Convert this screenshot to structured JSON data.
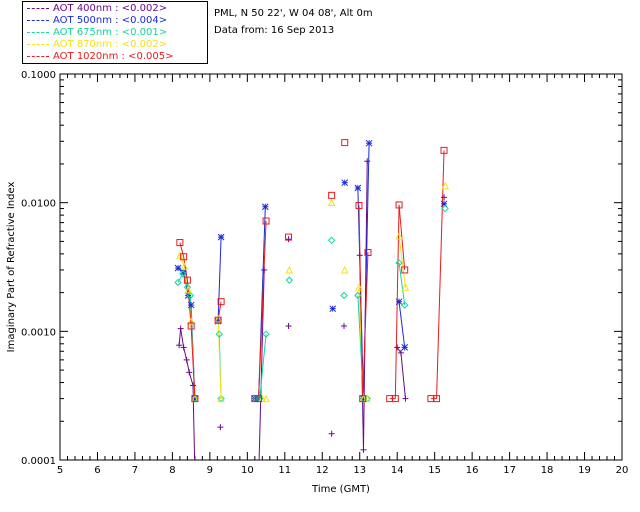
{
  "header": {
    "site": "PML, N 50 22', W 04 08', Alt 0m",
    "date": "Data from: 16 Sep 2013"
  },
  "chart_data": {
    "type": "scatter",
    "log_y": true,
    "xlabel": "Time (GMT)",
    "ylabel": "Imaginary Part of Refractive Index",
    "xlim": [
      5,
      20
    ],
    "ylim": [
      0.0001,
      0.1
    ],
    "x_ticks": [
      "5",
      "6",
      "7",
      "8",
      "9",
      "10",
      "11",
      "12",
      "13",
      "14",
      "15",
      "16",
      "17",
      "18",
      "19",
      "20"
    ],
    "y_ticks": [
      {
        "value": 0.0001,
        "label": "0.0001"
      },
      {
        "value": 0.001,
        "label": "0.0010"
      },
      {
        "value": 0.01,
        "label": "0.0100"
      },
      {
        "value": 0.1,
        "label": "0.1000"
      }
    ],
    "legend_position": "top-left (outside plot)",
    "series": [
      {
        "name": "AOT  400nm : <0.002>",
        "color": "#6a0a8c",
        "marker": "plus",
        "points": [
          [
            8.18,
            0.00078
          ],
          [
            8.22,
            0.00105
          ],
          [
            8.3,
            0.00075
          ],
          [
            8.38,
            0.0006
          ],
          [
            8.45,
            0.00048
          ],
          [
            8.55,
            0.00038
          ],
          [
            8.6,
            8e-05
          ],
          [
            9.28,
            0.00018
          ],
          [
            10.3,
            7e-05
          ],
          [
            10.45,
            0.003
          ],
          [
            11.1,
            0.0011
          ],
          [
            11.1,
            0.0052
          ],
          [
            12.25,
            0.00016
          ],
          [
            12.58,
            0.0011
          ],
          [
            13.0,
            0.0039
          ],
          [
            13.1,
            0.00012
          ],
          [
            13.2,
            0.021
          ],
          [
            14.0,
            0.00075
          ],
          [
            14.1,
            0.00068
          ],
          [
            14.22,
            0.0003
          ],
          [
            15.25,
            0.011
          ]
        ],
        "segments": [
          [
            0,
            1
          ],
          [
            1,
            2
          ],
          [
            2,
            3
          ],
          [
            3,
            4
          ],
          [
            4,
            5
          ],
          [
            5,
            6
          ],
          [
            8,
            9
          ],
          [
            14,
            15
          ],
          [
            15,
            16
          ],
          [
            17,
            18
          ],
          [
            18,
            19
          ]
        ]
      },
      {
        "name": "AOT  500nm : <0.004>",
        "color": "#1a2ad8",
        "marker": "star",
        "points": [
          [
            8.15,
            0.0031
          ],
          [
            8.3,
            0.0029
          ],
          [
            8.42,
            0.0019
          ],
          [
            8.5,
            0.0016
          ],
          [
            8.6,
            0.0003
          ],
          [
            9.22,
            0.0012
          ],
          [
            9.3,
            0.0054
          ],
          [
            10.2,
            0.0003
          ],
          [
            10.3,
            0.0003
          ],
          [
            10.48,
            0.0093
          ],
          [
            12.28,
            0.0015
          ],
          [
            12.6,
            0.0143
          ],
          [
            12.95,
            0.013
          ],
          [
            13.1,
            0.0003
          ],
          [
            13.25,
            0.029
          ],
          [
            14.05,
            0.0017
          ],
          [
            14.2,
            0.00075
          ],
          [
            15.25,
            0.0098
          ]
        ],
        "segments": [
          [
            0,
            1
          ],
          [
            1,
            2
          ],
          [
            2,
            3
          ],
          [
            3,
            4
          ],
          [
            5,
            6
          ],
          [
            7,
            8
          ],
          [
            8,
            9
          ],
          [
            12,
            13
          ],
          [
            13,
            14
          ],
          [
            15,
            16
          ]
        ]
      },
      {
        "name": "AOT  675nm : <0.001>",
        "color": "#14d4a0",
        "marker": "diamond",
        "points": [
          [
            8.15,
            0.0024
          ],
          [
            8.28,
            0.0028
          ],
          [
            8.4,
            0.0022
          ],
          [
            8.48,
            0.0019
          ],
          [
            8.6,
            0.0003
          ],
          [
            9.25,
            0.00095
          ],
          [
            9.3,
            0.0003
          ],
          [
            10.25,
            0.0003
          ],
          [
            10.33,
            0.0003
          ],
          [
            10.5,
            0.00095
          ],
          [
            11.12,
            0.0025
          ],
          [
            12.25,
            0.0051
          ],
          [
            12.58,
            0.0019
          ],
          [
            12.95,
            0.0019
          ],
          [
            13.1,
            0.0003
          ],
          [
            13.2,
            0.0003
          ],
          [
            14.05,
            0.0034
          ],
          [
            14.2,
            0.0016
          ],
          [
            15.28,
            0.009
          ]
        ],
        "segments": [
          [
            0,
            1
          ],
          [
            1,
            2
          ],
          [
            2,
            3
          ],
          [
            3,
            4
          ],
          [
            5,
            6
          ],
          [
            7,
            8
          ],
          [
            8,
            9
          ],
          [
            13,
            14
          ],
          [
            16,
            17
          ]
        ]
      },
      {
        "name": "AOT  870nm : <0.002>",
        "color": "#f2e21a",
        "marker": "triangle",
        "points": [
          [
            8.2,
            0.0039
          ],
          [
            8.32,
            0.0032
          ],
          [
            8.42,
            0.0021
          ],
          [
            8.5,
            0.0012
          ],
          [
            8.6,
            0.0003
          ],
          [
            9.22,
            0.00125
          ],
          [
            9.3,
            0.0003
          ],
          [
            10.4,
            0.0003
          ],
          [
            10.5,
            0.0003
          ],
          [
            11.12,
            0.003
          ],
          [
            12.25,
            0.01
          ],
          [
            12.6,
            0.003
          ],
          [
            12.98,
            0.0022
          ],
          [
            13.1,
            0.0003
          ],
          [
            13.2,
            0.0003
          ],
          [
            14.05,
            0.0055
          ],
          [
            14.22,
            0.0022
          ],
          [
            15.28,
            0.0135
          ]
        ],
        "segments": [
          [
            0,
            1
          ],
          [
            1,
            2
          ],
          [
            2,
            3
          ],
          [
            3,
            4
          ],
          [
            5,
            6
          ],
          [
            7,
            8
          ],
          [
            12,
            13
          ],
          [
            15,
            16
          ]
        ]
      },
      {
        "name": "AOT 1020nm : <0.005>",
        "color": "#e81c1c",
        "marker": "square",
        "points": [
          [
            8.2,
            0.0049
          ],
          [
            8.3,
            0.0038
          ],
          [
            8.4,
            0.0025
          ],
          [
            8.5,
            0.0011
          ],
          [
            8.6,
            0.0003
          ],
          [
            9.22,
            0.00122
          ],
          [
            9.3,
            0.0017
          ],
          [
            10.2,
            0.0003
          ],
          [
            10.3,
            0.0003
          ],
          [
            10.5,
            0.0072
          ],
          [
            11.1,
            0.0054
          ],
          [
            12.25,
            0.0114
          ],
          [
            12.6,
            0.0293
          ],
          [
            12.98,
            0.0095
          ],
          [
            13.08,
            0.0003
          ],
          [
            13.22,
            0.0041
          ],
          [
            13.8,
            0.0003
          ],
          [
            13.95,
            0.0003
          ],
          [
            14.05,
            0.0096
          ],
          [
            14.2,
            0.003
          ],
          [
            14.9,
            0.0003
          ],
          [
            15.05,
            0.0003
          ],
          [
            15.25,
            0.0255
          ]
        ],
        "segments": [
          [
            0,
            1
          ],
          [
            1,
            2
          ],
          [
            2,
            3
          ],
          [
            3,
            4
          ],
          [
            5,
            6
          ],
          [
            7,
            8
          ],
          [
            8,
            9
          ],
          [
            13,
            14
          ],
          [
            14,
            15
          ],
          [
            16,
            17
          ],
          [
            17,
            18
          ],
          [
            18,
            19
          ],
          [
            20,
            21
          ],
          [
            21,
            22
          ]
        ]
      }
    ]
  }
}
